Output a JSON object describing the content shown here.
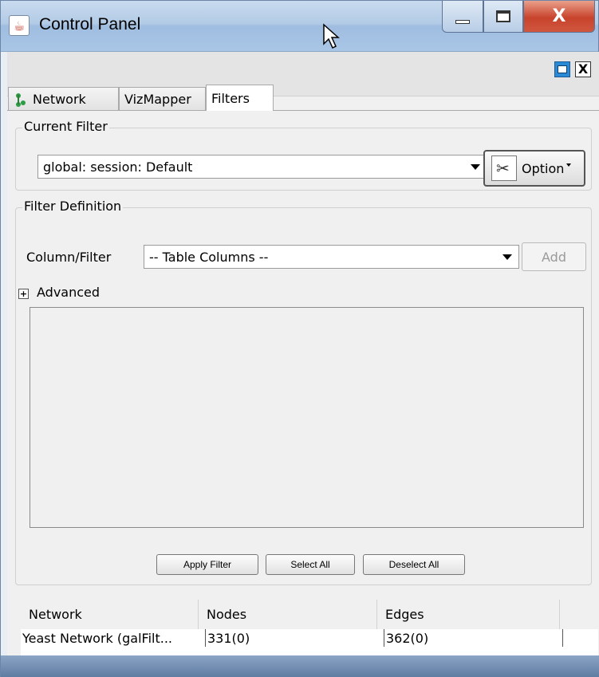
{
  "window": {
    "title": "Control Panel",
    "app_icon_glyph": "☕",
    "close_glyph": "X"
  },
  "panel": {
    "close_glyph": "X"
  },
  "tabs": [
    {
      "label": "Network",
      "icon": "network-icon",
      "active": false
    },
    {
      "label": "VizMapper",
      "active": false
    },
    {
      "label": "Filters",
      "active": true
    }
  ],
  "current_filter": {
    "group_title": "Current Filter",
    "selected": "global: session: Default",
    "option_label": "Option"
  },
  "filter_definition": {
    "group_title": "Filter Definition",
    "column_filter_label": "Column/Filter",
    "column_selected": "-- Table Columns --",
    "add_label": "Add",
    "advanced_label": "Advanced",
    "expander_glyph": "+"
  },
  "actions": {
    "apply": "Apply Filter",
    "select_all": "Select All",
    "deselect_all": "Deselect All"
  },
  "table": {
    "headers": [
      "Network",
      "Nodes",
      "Edges"
    ],
    "rows": [
      [
        "Yeast Network (galFilt...",
        "331(0)",
        "362(0)"
      ]
    ]
  },
  "colors": {
    "titlebar": "#b3cbe6",
    "close_button": "#c8432c",
    "panel_bg": "#f0f0f0"
  }
}
